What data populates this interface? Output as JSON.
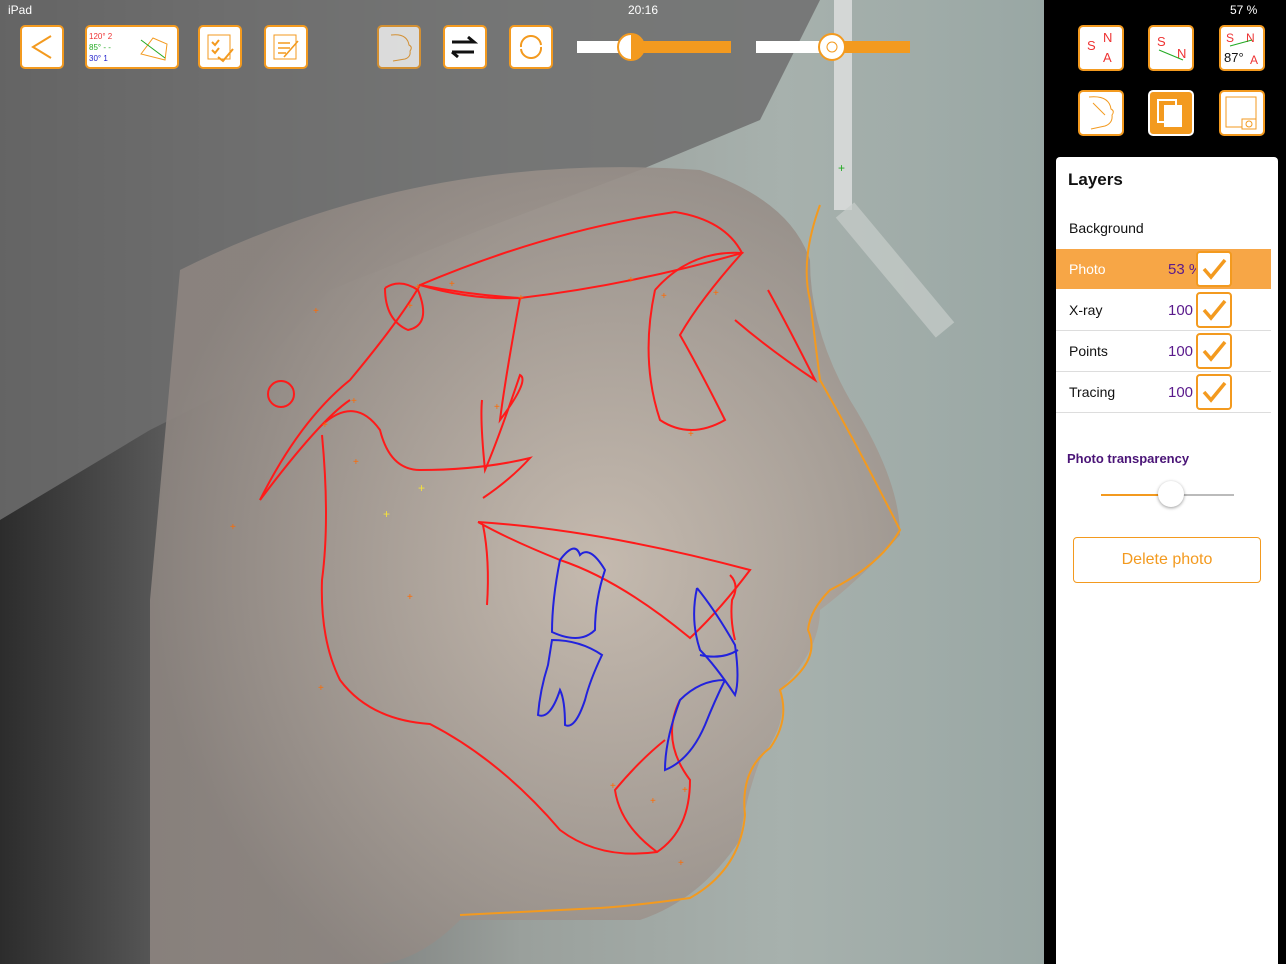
{
  "status_bar": {
    "device": "iPad",
    "time": "20:16",
    "battery": "57 %"
  },
  "toolbar": {
    "angle_widget": {
      "line1": "120° 2",
      "line2": "85° - -",
      "line3": "30° 1"
    }
  },
  "right_buttons": {
    "sna_tool_label": "87°"
  },
  "layers_panel": {
    "title": "Layers",
    "background_label": "Background",
    "rows": [
      {
        "name": "Photo",
        "percent": "53 %",
        "checked": true,
        "selected": true
      },
      {
        "name": "X-ray",
        "percent": "100 %",
        "checked": true,
        "selected": false
      },
      {
        "name": "Points",
        "percent": "100 %",
        "checked": true,
        "selected": false
      },
      {
        "name": "Tracing",
        "percent": "100 %",
        "checked": true,
        "selected": false
      }
    ],
    "transparency_label": "Photo transparency",
    "transparency_level": 0.53,
    "delete_button_label": "Delete photo"
  },
  "colors": {
    "accent": "#f39a1f",
    "tracing": "#ff1a1a",
    "teeth": "#2222dd",
    "soft_tissue": "#f39a1f",
    "percent_text": "#5a1a8c"
  }
}
